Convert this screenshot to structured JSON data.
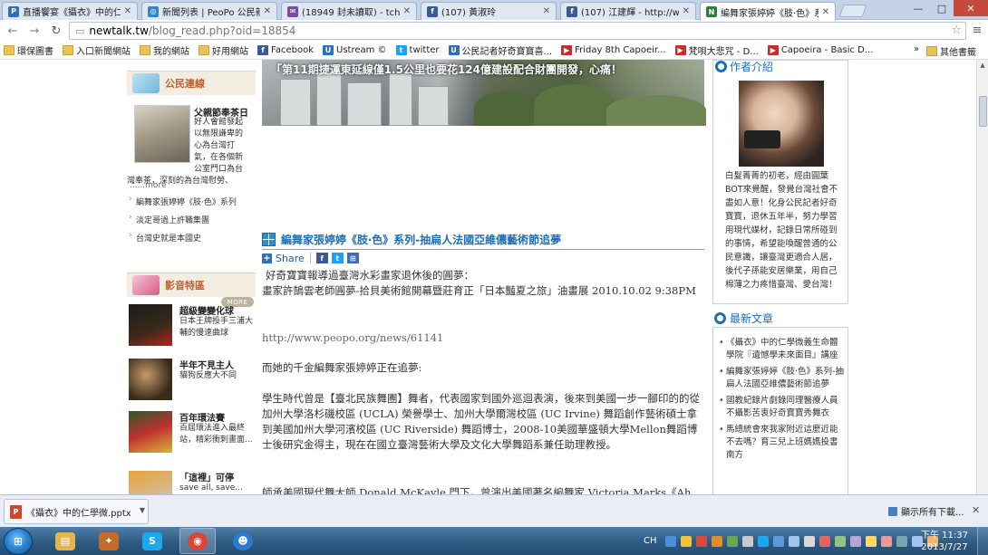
{
  "browser": {
    "tabs": [
      {
        "icon": "peopo-icon",
        "label": "直播饗宴《攝衣》中的仁...",
        "color": "#2f6fb6"
      },
      {
        "icon": "globe-icon",
        "label": "新聞列表 | PeoPo 公民新...",
        "color": "#2f86c8"
      },
      {
        "icon": "mail-icon",
        "label": "(18949 封未讀取) - tchan",
        "color": "#7b4a9e"
      },
      {
        "icon": "facebook-icon",
        "label": "(107) 黃淑玲",
        "color": "#3b5998"
      },
      {
        "icon": "facebook-icon",
        "label": "(107) 江建輝 - http://www...",
        "color": "#3b5998"
      },
      {
        "icon": "newtalk-icon",
        "label": "編舞家張婷婷《肢‧色》系...",
        "color": "#2b7d3f"
      }
    ],
    "window_controls": [
      "—",
      "□",
      "✕"
    ],
    "url_host": "newtalk.tw",
    "url_path": "/blog_read.php?oid=18854",
    "bookmarks": [
      {
        "label": "環保圖書",
        "icon": "folder-icon",
        "color": "#e8c35a"
      },
      {
        "label": "入口新聞網站",
        "icon": "folder-icon",
        "color": "#e8c35a"
      },
      {
        "label": "我的網站",
        "icon": "folder-icon",
        "color": "#e8c35a"
      },
      {
        "label": "好用網站",
        "icon": "folder-icon",
        "color": "#e8c35a"
      },
      {
        "label": "Facebook",
        "icon": "facebook-icon",
        "color": "#3b5998"
      },
      {
        "label": "Ustream ©",
        "icon": "ustream-icon",
        "color": "#2b6fbe"
      },
      {
        "label": "twitter",
        "icon": "twitter-icon",
        "color": "#1da1f2"
      },
      {
        "label": "公民記者好奇寶寶喜...",
        "icon": "peopo-icon",
        "color": "#2f6fb6"
      },
      {
        "label": "Friday 8th Capoeir...",
        "icon": "youtube-icon",
        "color": "#c4302b"
      },
      {
        "label": "梵唄大悲咒 - D...",
        "icon": "youtube-icon",
        "color": "#c4302b"
      },
      {
        "label": "Capoeira - Basic D...",
        "icon": "youtube-icon",
        "color": "#c4302b"
      }
    ],
    "bookmarks_more": "»",
    "other_bookmarks": "其他書籤"
  },
  "page": {
    "left": {
      "civic_header": "公民連線",
      "civic_title": "父親節奉茶日",
      "civic_text_lines": [
        "好人會館發起",
        "以無限謙卑的",
        "心為台灣打",
        "氣，在各個新",
        "公室門口為台",
        "灣奉茶，深刻的為台灣慰勞、"
      ],
      "civic_more": "......more",
      "civic_links": [
        "編舞家張婷婷《肢‧色》系列",
        "淡定哥過上許職集團",
        "台灣史就是本國史"
      ],
      "more_button": "MORE",
      "video_header": "影音特區",
      "videos": [
        {
          "title": "超級變變化球",
          "desc": "日本王牌投手三浦大輔的慢速曲球"
        },
        {
          "title": "半年不見主人",
          "desc": "貓狗反應大不同"
        },
        {
          "title": "百年環法賽",
          "desc": "百屆環法進入最終站，精彩衝刺畫面..."
        },
        {
          "title": "「這裡」可停",
          "desc": "save all, save..."
        }
      ]
    },
    "main": {
      "hero_caption": "「第11期捷運東延線僅1.5公里也要花124億建設配合財團開發，心痛！",
      "post_title": "編舞家張婷婷《肢‧色》系列-抽扁人法國亞維儂藝術節追夢",
      "share_label": "Share",
      "paragraphs": [
        "好奇寶寶報導過臺灣水彩畫家退休後的圓夢：",
        "畫家許鵠雲老師圓夢-拾貝美術館開幕暨莊育正「日本豔夏之旅」油畫展 2010.10.02 9:38PM",
        "http://www.peopo.org/news/61141",
        "而她的千金編舞家張婷婷正在追夢:",
        "學生時代曾是【臺北民族舞團】舞者，代表國家到國外巡迴表演，後來到美國一步一腳印的的從加州大學洛杉磯校區 (UCLA) 榮譽學士、加州大學爾灣校區 (UC Irvine) 舞蹈創作藝術碩士拿到美國加州大學河濱校區 (UC Riverside) 舞蹈博士，2008-10美國華盛頓大學Mellon舞蹈博士後研究金得主，現在在國立臺灣藝術大學及文化大學舞蹈系兼任助理教授。",
        "師承美國現代舞大師 Donald McKayle 門下，曾演出美國著名編舞家 Victoria Marks《Ah..."
      ]
    },
    "right": {
      "author_header": "作者介紹",
      "author_text": "白髮菁菁的初老，經由圓葉BOT來覺醒，發覺台灣社會不盡如人意！化身公民記者好奇寶寶，退休五年半，努力學習用現代媒材，記錄日常所碰到的事情，希望能喚醒普通的公民意識，讓臺灣更適合人居，後代子孫能安居樂業，用自己棉薄之力疼惜臺灣、愛台灣！",
      "latest_header": "最新文章",
      "latest": [
        "《攝衣》中的仁學微義生命體學院『遺憾學未來面目』講座",
        "編舞家張婷婷《肢‧色》系列-抽扁人法國亞維儂藝術節追夢",
        "國教紀錄片劇錄同理醫療人員不攝影苦衷好奇寶寶秀舞衣",
        "馬總統會來我家附近這麼近能不去嗎？育三兒上班媽媽投書南方"
      ]
    }
  },
  "download": {
    "file": "《攝衣》中的仁學微.pptx",
    "show_all": "顯示所有下載...",
    "close": "✕"
  },
  "taskbar": {
    "lang": "CH",
    "time": "下午 11:37",
    "date": "2013/7/27",
    "apps": [
      {
        "name": "explorer-icon",
        "glyph": "▤",
        "color": "#e2b64a"
      },
      {
        "name": "tools-icon",
        "glyph": "✦",
        "color": "#c46a2b"
      },
      {
        "name": "skype-icon",
        "glyph": "S",
        "color": "#1aa7ec"
      },
      {
        "name": "chrome-icon",
        "glyph": "◉",
        "color": "#d9473b"
      },
      {
        "name": "messenger-icon",
        "glyph": "☻",
        "color": "#2b7ad1"
      }
    ]
  }
}
